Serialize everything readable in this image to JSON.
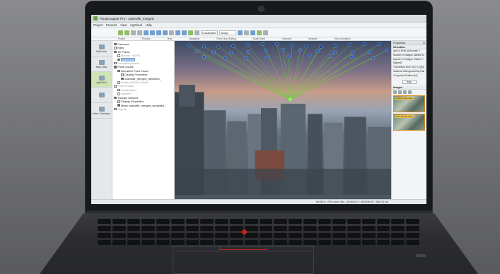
{
  "app": {
    "title": "Pix4Dmapper Pro - nashville_merged",
    "menu": [
      "Project",
      "Process",
      "View",
      "rayCloud",
      "Help"
    ],
    "toolbar_groups": [
      "Project",
      "Process",
      "View",
      "Navigation",
      "Point Cloud Editing",
      "Scale/Orient",
      "Selection",
      "Measure",
      "Video Animation"
    ],
    "toolbar_select": "Unclassified",
    "toolbar_assign": "Assign"
  },
  "leftnav": [
    {
      "label": "Welcome",
      "active": false
    },
    {
      "label": "Map View",
      "active": false
    },
    {
      "label": "rayCloud",
      "active": true
    },
    {
      "label": "",
      "active": false
    },
    {
      "label": "Index Calculator",
      "active": false
    }
  ],
  "tree": [
    {
      "label": "Cameras",
      "level": 0,
      "checked": true,
      "muted": false,
      "selected": false
    },
    {
      "label": "Rays",
      "level": 0,
      "checked": false,
      "muted": false,
      "selected": false
    },
    {
      "label": "Tie Points",
      "level": 0,
      "checked": true,
      "muted": false,
      "selected": false
    },
    {
      "label": "Manual / MTPs",
      "level": 1,
      "checked": false,
      "muted": true,
      "selected": false
    },
    {
      "label": "Automatic",
      "level": 1,
      "checked": true,
      "muted": false,
      "selected": true
    },
    {
      "label": "Processing Areas",
      "level": 0,
      "checked": false,
      "muted": true,
      "selected": false
    },
    {
      "label": "Point Clouds",
      "level": 0,
      "checked": true,
      "muted": false,
      "selected": false
    },
    {
      "label": "Densified Point Cloud",
      "level": 1,
      "checked": true,
      "muted": false,
      "selected": false
    },
    {
      "label": "Display Properties",
      "level": 2,
      "checked": false,
      "muted": false,
      "selected": false
    },
    {
      "label": "nashville_merged_densified_",
      "level": 2,
      "checked": true,
      "muted": false,
      "selected": false
    },
    {
      "label": "External Point Clouds",
      "level": 1,
      "checked": false,
      "muted": true,
      "selected": false
    },
    {
      "label": "Point Groups",
      "level": 0,
      "checked": false,
      "muted": true,
      "selected": false
    },
    {
      "label": "Unclassified",
      "level": 1,
      "checked": false,
      "muted": true,
      "selected": false
    },
    {
      "label": "Deleted",
      "level": 1,
      "checked": false,
      "muted": true,
      "selected": false
    },
    {
      "label": "Triangle Meshes",
      "level": 0,
      "checked": true,
      "muted": false,
      "selected": false
    },
    {
      "label": "Display Properties",
      "level": 1,
      "checked": false,
      "muted": false,
      "selected": false
    },
    {
      "label": "Mesh nashville_merged_simplified_",
      "level": 1,
      "checked": true,
      "muted": false,
      "selected": false
    },
    {
      "label": "Objects",
      "level": 0,
      "checked": false,
      "muted": true,
      "selected": false
    }
  ],
  "properties": {
    "header": "Properties",
    "selection_title": "Selection",
    "rows": [
      "atp 91,3346 (Automatic T",
      "Number of Images Marked In",
      "Number of Images Visible In",
      "5/[pixel]",
      "Theoretical Error S(X,Y,Z)[m]",
      "Maximal Orthogonal Ray Dist",
      "Computed Position [m]"
    ],
    "help_label": "Help",
    "images_title": "Images",
    "thumbs": [
      "0.388 (0.434 px/m)",
      "0.407 (0.437 px/m)"
    ]
  },
  "status": {
    "text": "WGS84 / UTM zone 16N - (520825.27, 4002084.37, 388.20) [m]"
  }
}
